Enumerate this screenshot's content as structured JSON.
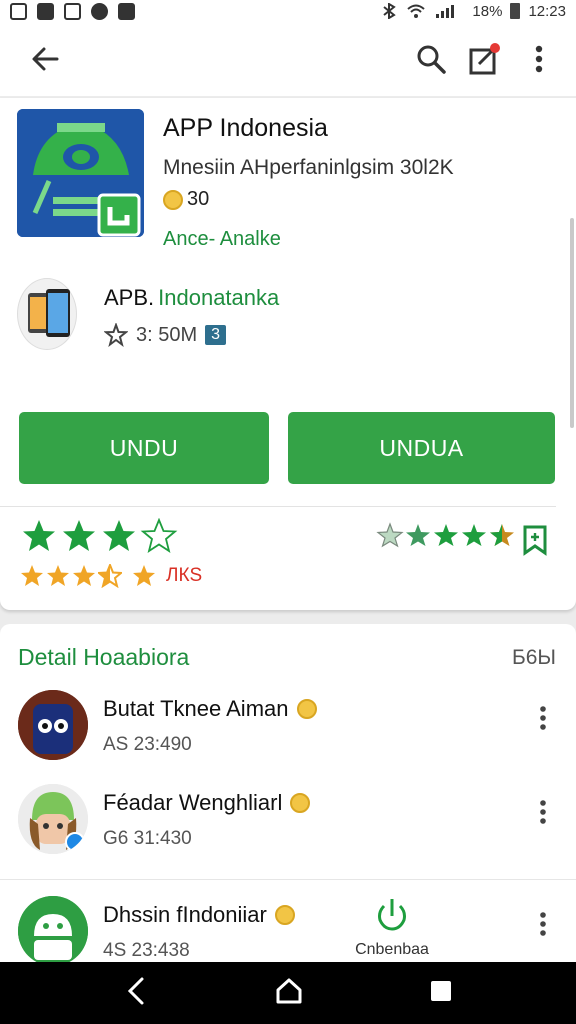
{
  "status_bar": {
    "battery": "18%",
    "time": "12:23"
  },
  "hero": {
    "title": "APP Indonesia",
    "subtitle": "Mnesiin AHperfaninlgsim 30l2K",
    "rating": "30",
    "category": "Ance- Analke"
  },
  "developer": {
    "name_prefix": "APB.",
    "name_link": "Indonatanka",
    "meta": "3: 50M",
    "badge": "3"
  },
  "buttons": {
    "primary": "UNDU",
    "secondary": "UNDUA"
  },
  "ratings": {
    "reviews": "ЛКS"
  },
  "section": {
    "title": "Detail Hoaabiora",
    "more": "Б6Ы"
  },
  "list": [
    {
      "name": "Butat Tknee Aiman",
      "meta": "AS 23:490"
    },
    {
      "name": "Féadar Wenghliarl",
      "meta": "G6 31:430"
    },
    {
      "name": "Dhssin fIndoniiar",
      "meta": "4S 23:438",
      "action": "Cnbenbaa"
    }
  ],
  "colors": {
    "accent": "#34a347",
    "link": "#1e8e3e",
    "star": "#1e9e3e",
    "star_orange": "#f0a526"
  }
}
